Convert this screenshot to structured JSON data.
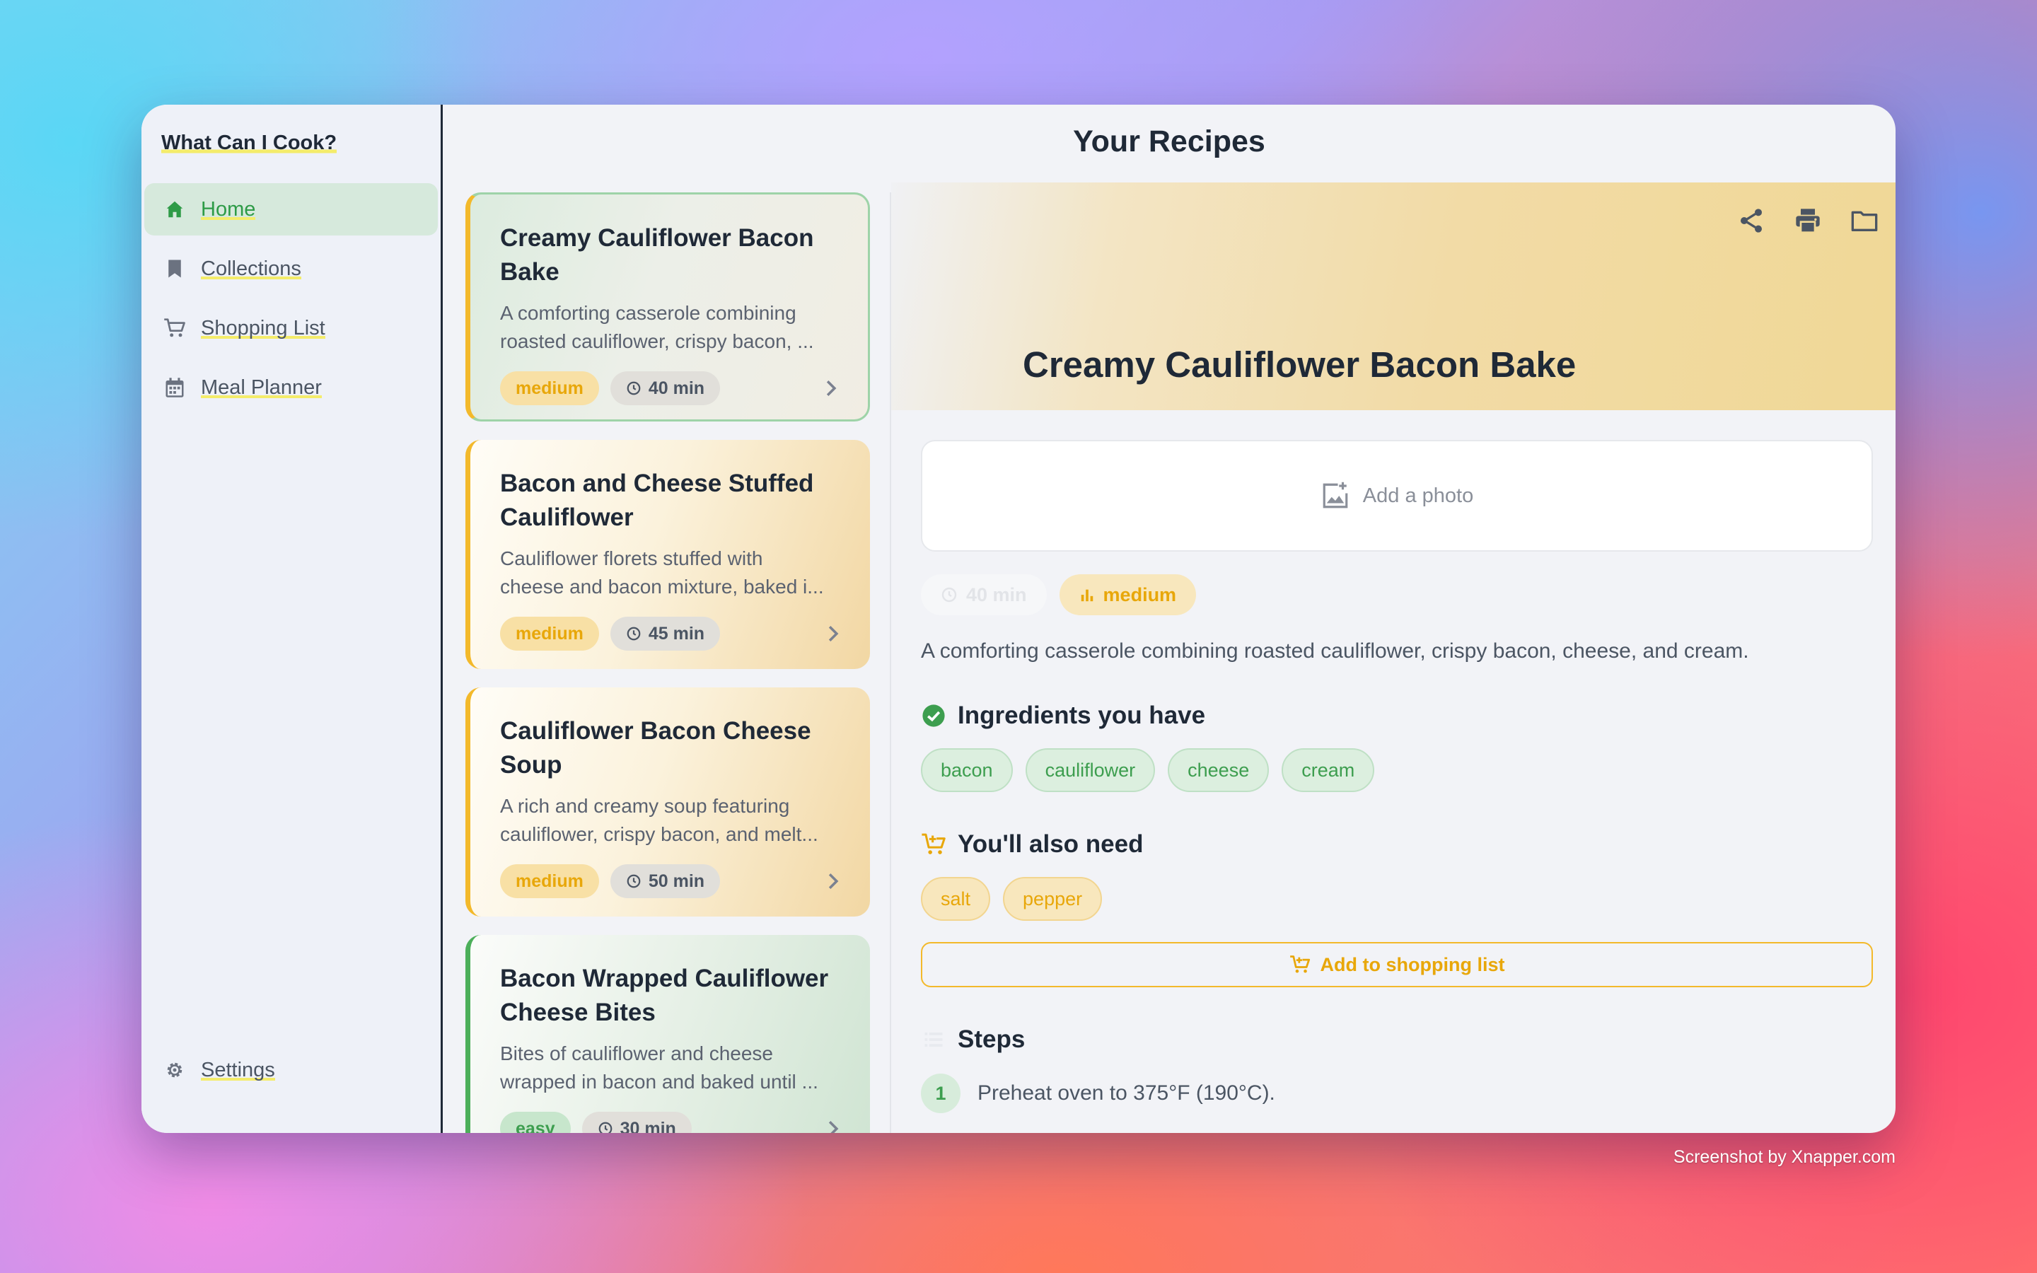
{
  "app": {
    "title": "What Can I Cook?"
  },
  "sidebar": {
    "items": [
      {
        "label": "Home",
        "icon": "home-icon",
        "active": true
      },
      {
        "label": "Collections",
        "icon": "bookmark-icon"
      },
      {
        "label": "Shopping List",
        "icon": "cart-icon"
      },
      {
        "label": "Meal Planner",
        "icon": "calendar-icon"
      }
    ],
    "settings": {
      "label": "Settings",
      "icon": "gear-icon"
    }
  },
  "page": {
    "title": "Your Recipes"
  },
  "recipes": [
    {
      "title": "Creamy Cauliflower Bacon Bake",
      "desc1": "A comforting casserole combining",
      "desc2": "roasted cauliflower, crispy bacon, ...",
      "difficulty": "medium",
      "time": "40 min"
    },
    {
      "title": "Bacon and Cheese Stuffed Cauliflower",
      "desc1": "Cauliflower florets stuffed with",
      "desc2": "cheese and bacon mixture, baked i...",
      "difficulty": "medium",
      "time": "45 min"
    },
    {
      "title": "Cauliflower Bacon Cheese Soup",
      "desc1": "A rich and creamy soup featuring",
      "desc2": "cauliflower, crispy bacon, and melt...",
      "difficulty": "medium",
      "time": "50 min"
    },
    {
      "title": "Bacon Wrapped Cauliflower Cheese Bites",
      "desc1": "Bites of cauliflower and cheese",
      "desc2": "wrapped in bacon and baked until ...",
      "difficulty": "easy",
      "time": "30 min"
    }
  ],
  "detail": {
    "title": "Creamy Cauliflower Bacon Bake",
    "add_photo": "Add a photo",
    "time": "40 min",
    "difficulty": "medium",
    "description": "A comforting casserole combining roasted cauliflower, crispy bacon, cheese, and cream.",
    "have_heading": "Ingredients you have",
    "have": [
      "bacon",
      "cauliflower",
      "cheese",
      "cream"
    ],
    "need_heading": "You'll also need",
    "need": [
      "salt",
      "pepper"
    ],
    "add_to_list": "Add to shopping list",
    "steps_heading": "Steps",
    "steps": [
      {
        "num": "1",
        "text": "Preheat oven to 375°F (190°C)."
      }
    ]
  },
  "credit": "Screenshot by Xnapper.com",
  "colors": {
    "accent_green": "#3d9e4f",
    "accent_yellow": "#e8a70a",
    "yellow_border": "#f3b92b"
  }
}
